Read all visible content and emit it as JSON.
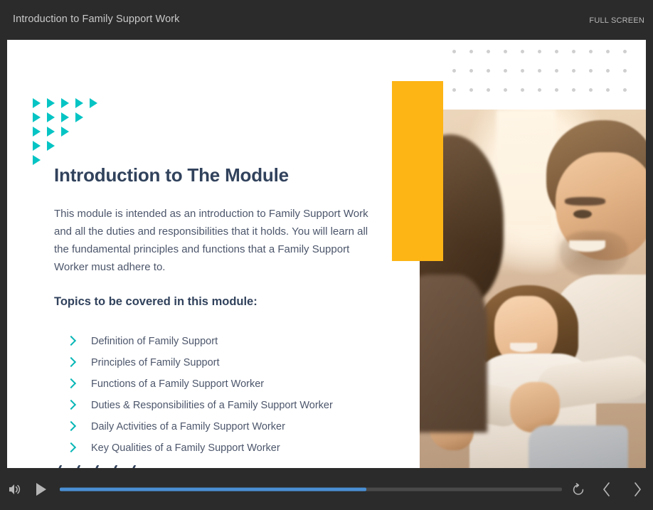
{
  "player": {
    "course_title": "Introduction to Family Support Work",
    "fullscreen_label": "FULL SCREEN"
  },
  "slide": {
    "heading": "Introduction to The Module",
    "intro_paragraph": "This module is intended as an introduction to Family Support Work and all the duties and responsibilities that it holds. You will learn all the fundamental principles and functions that a Family Support Worker must adhere to.",
    "topics_heading": "Topics to be covered in this module:",
    "topics": [
      "Definition of Family Support",
      "Principles of Family Support",
      "Functions of a Family Support Worker",
      "Duties & Responsibilities of a Family Support Worker",
      "Daily Activities of a Family Support Worker",
      "Key Qualities of a Family Support Worker"
    ],
    "decorations": {
      "triangle_rows": [
        5,
        4,
        3,
        2,
        1
      ],
      "slash_count": 5,
      "dot_grid_columns": 11,
      "dot_grid_rows": 3
    },
    "photo_description": "Family photograph: smiling man, woman and young girl seated together in warm sunlight"
  },
  "controls": {
    "volume_icon": "volume-icon",
    "play_icon": "play-icon",
    "replay_icon": "replay-icon",
    "prev_icon": "chevron-left-icon",
    "next_icon": "chevron-right-icon",
    "progress_percent": 61
  },
  "colors": {
    "chrome": "#2b2b2b",
    "slide_background": "#ffffff",
    "accent_teal": "#09b6b6",
    "accent_yellow": "#fdb515",
    "heading_navy": "#31425c",
    "body_text": "#4c566b",
    "progress_fill": "#4a8fd4",
    "progress_track": "#4a4a4a",
    "dot_grid": "#cfcfcf"
  }
}
